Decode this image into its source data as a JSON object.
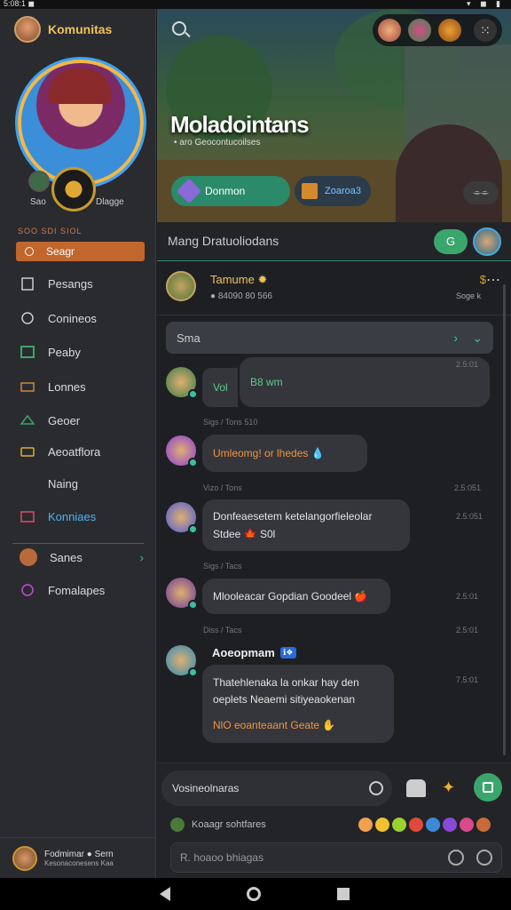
{
  "status": {
    "left": "5:08:1 ◼",
    "right": "▾ ◼ ▮"
  },
  "sidebar": {
    "title": "Komunitas",
    "label_left": "Sao",
    "label_right": "Dlagge",
    "section": "SOO SDI SIOL",
    "active_item": "Seagr",
    "items": [
      {
        "label": "Pesangs",
        "icon": "clipboard-icon",
        "color": "#dcdcdc"
      },
      {
        "label": "Conineos",
        "icon": "heart-icon",
        "color": "#dcdcdc"
      },
      {
        "label": "Peaby",
        "icon": "book-icon",
        "color": "#dcdcdc"
      },
      {
        "label": "Lonnes",
        "icon": "chat-icon",
        "color": "#dcdcdc"
      },
      {
        "label": "Geoer",
        "icon": "game-icon",
        "color": "#dcdcdc"
      },
      {
        "label": "Aeoatflora",
        "icon": "card-icon",
        "color": "#dcdcdc"
      },
      {
        "label": "Naing",
        "icon": "none",
        "color": "#dcdcdc"
      },
      {
        "label": "Konniaes",
        "icon": "calendar-icon",
        "color": "#4fb4f0"
      }
    ],
    "bottom_items": [
      {
        "label": "Sanes",
        "icon": "avatar-icon"
      },
      {
        "label": "Fomalapes",
        "icon": "heart-icon"
      }
    ],
    "footer_name": "Fodmimar ● Sern",
    "footer_sub": "Kesonaconesens Kaa"
  },
  "banner": {
    "title": "Moladointans",
    "subtitle": "• aro Geocontucoilses",
    "chip_green": "Donmon",
    "chip_green_sub": "• • •",
    "chip_dark": "Zoaroa3",
    "ctrl": "⌯⌯"
  },
  "channel": {
    "name": "Mang  Dratuoliodans",
    "g_label": "G"
  },
  "pinned": {
    "title": "Tamume ✹",
    "sub": "● 84090 80 566",
    "right": "$",
    "right_sub": "Soge k"
  },
  "thread": {
    "label": "Sma",
    "arrow": "›",
    "chev": "⌄"
  },
  "messages": [
    {
      "meta": "",
      "text_a": "Vol",
      "text_b": "B8 wm",
      "ts": "2.5:01"
    },
    {
      "meta": "Sigs / Tons      510",
      "text": "Umleomg! or lhedes 💧",
      "ts": ""
    },
    {
      "meta": "Vizo / Tons",
      "text": "Donfeaesetem ketelangorfieleolar",
      "text2": "Stdee 🍁 S0l",
      "ts": "2.5:051"
    },
    {
      "meta": "Sigs / Tacs",
      "text": "Mlooleacar Gopdian Goodeel 🍎",
      "ts": "2.5:01"
    },
    {
      "meta": "Diss / Tacs",
      "name": "Aoeopmam",
      "tag": "ℹ❖",
      "text": "Thatehlenaka la onkar hay den",
      "text2": "oeplets Neaemi sitiyeaokenan",
      "text3": "NlO eoanteaant Geate ✋",
      "ts": "7.5:01",
      "ts_top": "2.5:01"
    }
  ],
  "composer": {
    "placeholder": "Vosineolnaras",
    "react_label": "Koaagr sohtfares",
    "search_placeholder": "R.  hoaoo bhiagas"
  },
  "colors": {
    "accent_orange": "#c1662d",
    "accent_green": "#3aa66c",
    "link_blue": "#4fb4f0",
    "gold": "#f0c25a"
  }
}
